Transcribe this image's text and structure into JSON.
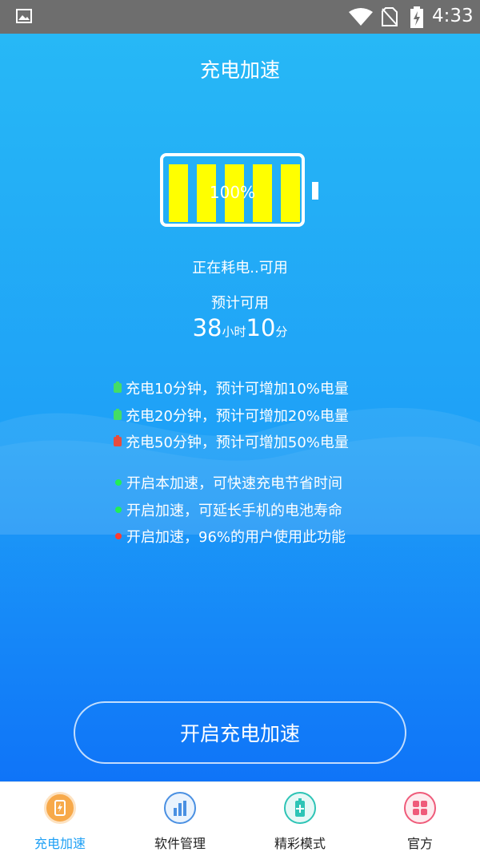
{
  "status_bar": {
    "time": "4:33",
    "icons": [
      "image-icon",
      "wifi-icon",
      "no-sim-icon",
      "battery-charging-icon"
    ]
  },
  "header": {
    "title": "充电加速"
  },
  "battery": {
    "percent_label": "100%",
    "level": 1.0,
    "bar_color": "#ffff00"
  },
  "status": {
    "text": "正在耗电..可用",
    "estimate_label": "预计可用",
    "hours": "38",
    "hours_unit": "小时",
    "minutes": "10",
    "minutes_unit": "分"
  },
  "charge_tips": [
    {
      "text": "充电10分钟，预计可增加10%电量",
      "icon_color": "#44dd66",
      "icon": "mini-battery-icon"
    },
    {
      "text": "充电20分钟，预计可增加20%电量",
      "icon_color": "#44dd66",
      "icon": "mini-battery-icon"
    },
    {
      "text": "充电50分钟，预计可增加50%电量",
      "icon_color": "#e84c3d",
      "icon": "mini-battery-icon"
    }
  ],
  "feature_tips": [
    {
      "text": "开启本加速，可快速充电节省时间",
      "dot_color": "#22ee55"
    },
    {
      "text": "开启加速，可延长手机的电池寿命",
      "dot_color": "#22ee55"
    },
    {
      "text": "开启加速，96%的用户使用此功能",
      "dot_color": "#ff3b30"
    }
  ],
  "cta": {
    "label": "开启充电加速"
  },
  "tabs": [
    {
      "label": "充电加速",
      "icon": "charge-icon",
      "active": true,
      "color": "#f7a94a"
    },
    {
      "label": "软件管理",
      "icon": "bar-chart-icon",
      "active": false,
      "color": "#4a90e2"
    },
    {
      "label": "精彩模式",
      "icon": "battery-mode-icon",
      "active": false,
      "color": "#2ec4b6"
    },
    {
      "label": "官方",
      "icon": "grid-icon",
      "active": false,
      "color": "#ef5b7a"
    }
  ],
  "colors": {
    "active_tab_text": "#1fa0f5"
  }
}
